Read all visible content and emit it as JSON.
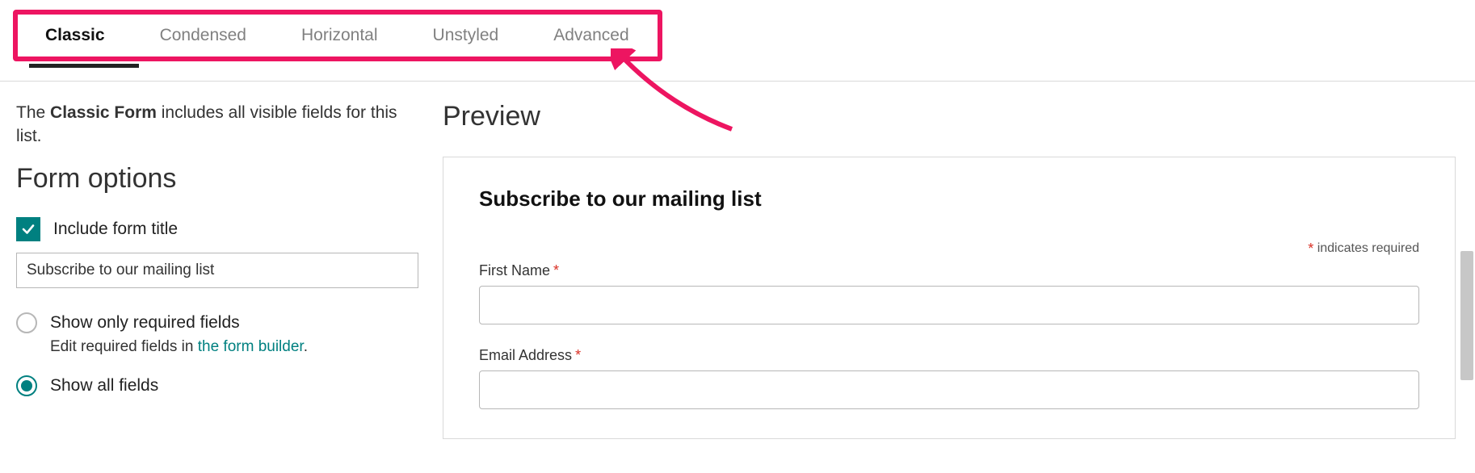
{
  "tabs": {
    "items": [
      {
        "label": "Classic",
        "active": true
      },
      {
        "label": "Condensed",
        "active": false
      },
      {
        "label": "Horizontal",
        "active": false
      },
      {
        "label": "Unstyled",
        "active": false
      },
      {
        "label": "Advanced",
        "active": false
      }
    ]
  },
  "description": {
    "prefix": "The ",
    "bold": "Classic Form",
    "suffix": " includes all visible fields for this list."
  },
  "form_options": {
    "heading": "Form options",
    "include_title_label": "Include form title",
    "include_title_checked": true,
    "title_value": "Subscribe to our mailing list",
    "radio_required_label": "Show only required fields",
    "radio_sub_prefix": "Edit required fields in ",
    "radio_sub_link": "the form builder",
    "radio_sub_suffix": ".",
    "radio_all_label": "Show all fields",
    "radio_selected": "all"
  },
  "preview": {
    "heading": "Preview",
    "form_title": "Subscribe to our mailing list",
    "required_note": "indicates required",
    "fields": [
      {
        "label": "First Name",
        "required": true
      },
      {
        "label": "Email Address",
        "required": true
      }
    ]
  },
  "annotation": {
    "highlight_color": "#ed1561"
  }
}
